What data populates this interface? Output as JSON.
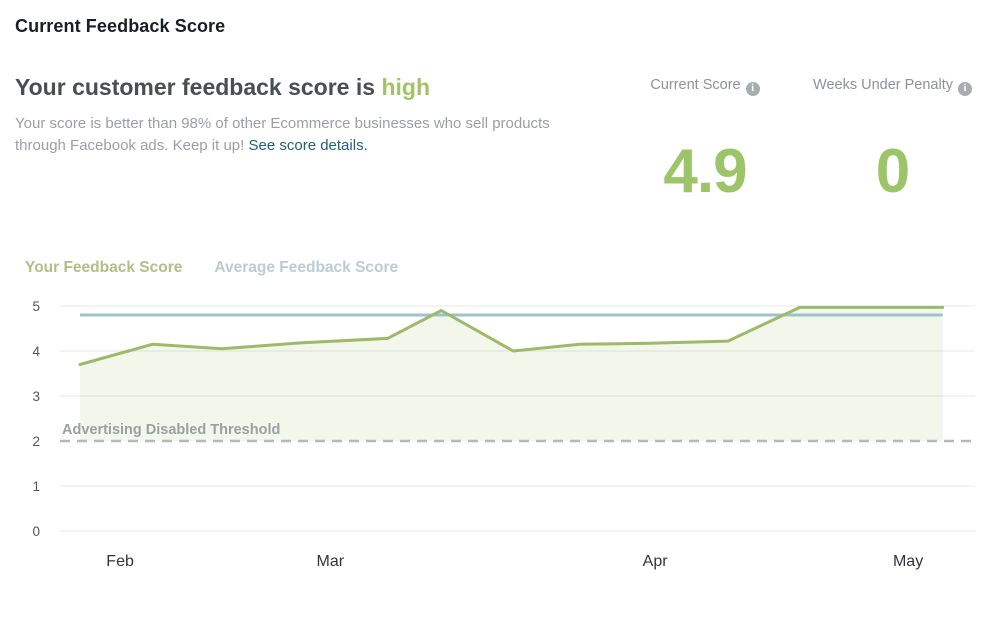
{
  "header": {
    "title": "Current Feedback Score"
  },
  "hero": {
    "heading": "Your customer feedback score is",
    "heading_highlight": "high",
    "description": "Your score is better than 98% of other Ecommerce businesses who sell products through Facebook ads. Keep it up!",
    "link_label": "See score details."
  },
  "stats": [
    {
      "label": "Current Score",
      "icon": "info-icon",
      "value": "4.9"
    },
    {
      "label": "Weeks Under Penalty",
      "icon": "info-icon",
      "value": "0"
    }
  ],
  "colors": {
    "highlight_green": "#a0c464",
    "big_number_green": "#9cc469",
    "link_teal": "#1f617a",
    "line_green": "#9cba68",
    "line_blue": "#a0c2d0",
    "threshold_gray": "#b6b9bc"
  },
  "chart_data": {
    "type": "line",
    "title": "",
    "xlabel": "",
    "ylabel": "",
    "ylim": [
      0,
      5
    ],
    "yticks": [
      0,
      1,
      2,
      3,
      4,
      5
    ],
    "grid": true,
    "legend_position": "top-left",
    "x_axis": {
      "labels": [
        "Feb",
        "Mar",
        "Apr",
        "May"
      ],
      "positions": [
        0.066,
        0.297,
        0.654,
        0.932
      ]
    },
    "threshold": {
      "value": 2,
      "label": "Advertising Disabled Threshold"
    },
    "series": [
      {
        "name": "Your Feedback Score",
        "type": "area-line",
        "color": "#9cba68",
        "fill": "rgba(156,186,104,0.13)",
        "x": [
          0.022,
          0.102,
          0.178,
          0.264,
          0.36,
          0.419,
          0.498,
          0.571,
          0.648,
          0.734,
          0.813,
          0.97
        ],
        "values": [
          3.7,
          4.15,
          4.05,
          4.18,
          4.28,
          4.9,
          4.0,
          4.15,
          4.17,
          4.22,
          4.97,
          4.97
        ]
      },
      {
        "name": "Average Feedback Score",
        "type": "line",
        "color": "#a0c2d0",
        "x": [
          0.022,
          0.97
        ],
        "values": [
          4.8,
          4.8
        ]
      }
    ]
  }
}
